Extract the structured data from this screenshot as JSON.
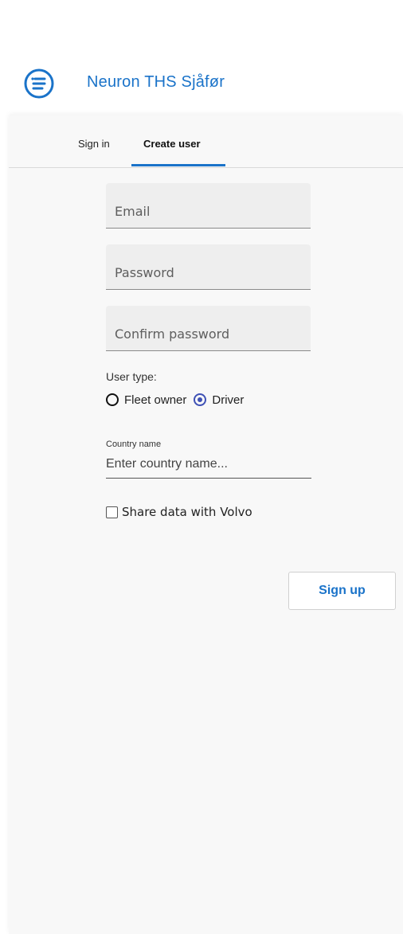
{
  "app": {
    "title": "Neuron THS Sjåfør",
    "menu_icon": "menu-list-icon",
    "accent_color": "#1a73c9"
  },
  "tabs": [
    {
      "label": "Sign in",
      "active": false
    },
    {
      "label": "Create user",
      "active": true
    }
  ],
  "form": {
    "email": {
      "placeholder": "Email",
      "value": ""
    },
    "password": {
      "placeholder": "Password",
      "value": ""
    },
    "confirm_password": {
      "placeholder": "Confirm password",
      "value": ""
    },
    "user_type": {
      "label": "User type:",
      "options": [
        {
          "label": "Fleet owner",
          "selected": false
        },
        {
          "label": "Driver",
          "selected": true
        }
      ]
    },
    "country": {
      "label": "Country name",
      "placeholder": "Enter country name...",
      "value": ""
    },
    "share_data": {
      "label": "Share data with Volvo",
      "checked": false
    },
    "submit_label": "Sign up"
  }
}
